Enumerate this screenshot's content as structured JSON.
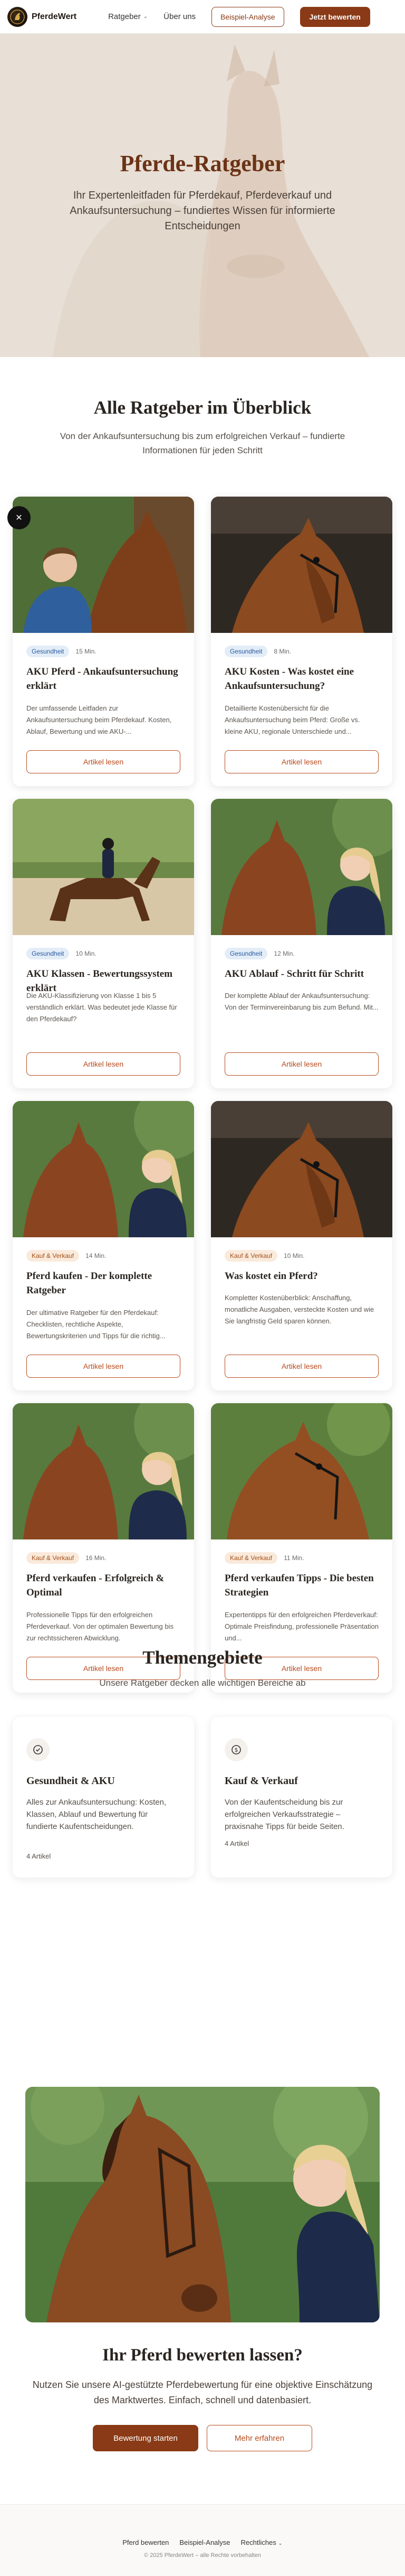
{
  "header": {
    "brand": "PferdeWert",
    "nav": [
      {
        "label": "Ratgeber",
        "has_dropdown": true
      },
      {
        "label": "Über uns",
        "has_dropdown": false
      }
    ],
    "secondary_button": "Beispiel-Analyse",
    "primary_button": "Jetzt bewerten"
  },
  "hero": {
    "title": "Pferde-Ratgeber",
    "subtitle": "Ihr Expertenleitfaden für Pferdekauf, Pferdeverkauf und Ankaufsuntersuchung – fundiertes Wissen für informierte Entscheidungen"
  },
  "overview": {
    "title": "Alle Ratgeber im Überblick",
    "subtitle": "Von der Ankaufsuntersuchung bis zum erfolgreichen Verkauf – fundierte Informationen für jeden Schritt",
    "articles": [
      {
        "category": "Gesundheit",
        "read_time": "15 Min.",
        "title": "AKU Pferd - Ankaufsuntersuchung erklärt",
        "excerpt": "Der umfassende Leitfaden zur Ankaufsuntersuchung beim Pferdekauf. Kosten, Ablauf, Bewertung und wie AKU-...",
        "button": "Artikel lesen"
      },
      {
        "category": "Gesundheit",
        "read_time": "8 Min.",
        "title": "AKU Kosten - Was kostet eine Ankaufsuntersuchung?",
        "excerpt": "Detaillierte Kostenübersicht für die Ankaufsuntersuchung beim Pferd: Große vs. kleine AKU, regionale Unterschiede und...",
        "button": "Artikel lesen"
      },
      {
        "category": "Gesundheit",
        "read_time": "10 Min.",
        "title": "AKU Klassen - Bewertungssystem erklärt",
        "excerpt": "Die AKU-Klassifizierung von Klasse 1 bis 5 verständlich erklärt. Was bedeutet jede Klasse für den Pferdekauf?",
        "button": "Artikel lesen"
      },
      {
        "category": "Gesundheit",
        "read_time": "12 Min.",
        "title": "AKU Ablauf - Schritt für Schritt",
        "excerpt": "Der komplette Ablauf der Ankaufsuntersuchung: Von der Terminvereinbarung bis zum Befund. Mit...",
        "button": "Artikel lesen"
      },
      {
        "category": "Kauf & Verkauf",
        "read_time": "14 Min.",
        "title": "Pferd kaufen - Der komplette Ratgeber",
        "excerpt": "Der ultimative Ratgeber für den Pferdekauf: Checklisten, rechtliche Aspekte, Bewertungskriterien und Tipps für die richtig...",
        "button": "Artikel lesen"
      },
      {
        "category": "Kauf & Verkauf",
        "read_time": "10 Min.",
        "title": "Was kostet ein Pferd?",
        "excerpt": "Kompletter Kostenüberblick: Anschaffung, monatliche Ausgaben, versteckte Kosten und wie Sie langfristig Geld sparen können.",
        "button": "Artikel lesen"
      },
      {
        "category": "Kauf & Verkauf",
        "read_time": "16 Min.",
        "title": "Pferd verkaufen - Erfolgreich & Optimal",
        "excerpt": "Professionelle Tipps für den erfolgreichen Pferdeverkauf. Von der optimalen Bewertung bis zur rechtssicheren Abwicklung.",
        "button": "Artikel lesen"
      },
      {
        "category": "Kauf & Verkauf",
        "read_time": "11 Min.",
        "title": "Pferd verkaufen Tipps - Die besten Strategien",
        "excerpt": "Expertentipps für den erfolgreichen Pferdeverkauf: Optimale Preisfindung, professionelle Präsentation und...",
        "button": "Artikel lesen"
      }
    ]
  },
  "topics": {
    "title": "Themengebiete",
    "subtitle": "Unsere Ratgeber decken alle wichtigen Bereiche ab",
    "items": [
      {
        "icon": "shield-check-icon",
        "title": "Gesundheit & AKU",
        "description": "Alles zur Ankaufsuntersuchung: Kosten, Klassen, Ablauf und Bewertung für fundierte Kaufentscheidungen.",
        "count": "4 Artikel"
      },
      {
        "icon": "dollar-icon",
        "title": "Kauf & Verkauf",
        "description": "Von der Kaufentscheidung bis zur erfolgreichen Verkaufsstrategie – praxisnahe Tipps für beide Seiten.",
        "count": "4 Artikel"
      }
    ]
  },
  "cta": {
    "title": "Ihr Pferd bewerten lassen?",
    "subtitle": "Nutzen Sie unsere AI-gestützte Pferdebewertung für eine objektive Einschätzung des Marktwertes. Einfach, schnell und datenbasiert.",
    "primary_button": "Bewertung starten",
    "secondary_button": "Mehr erfahren"
  },
  "footer": {
    "links": [
      {
        "label": "Pferd bewerten",
        "has_dropdown": false
      },
      {
        "label": "Beispiel-Analyse",
        "has_dropdown": false
      },
      {
        "label": "Rechtliches",
        "has_dropdown": true
      }
    ],
    "copyright": "© 2025 PferdeWert – alle Rechte vorbehalten"
  },
  "colors": {
    "brand": "#8a3a16",
    "accent": "#b74a1c",
    "hero_title": "#6b3316",
    "badge_health_bg": "#e3edf8",
    "badge_trade_bg": "#faeadb"
  }
}
